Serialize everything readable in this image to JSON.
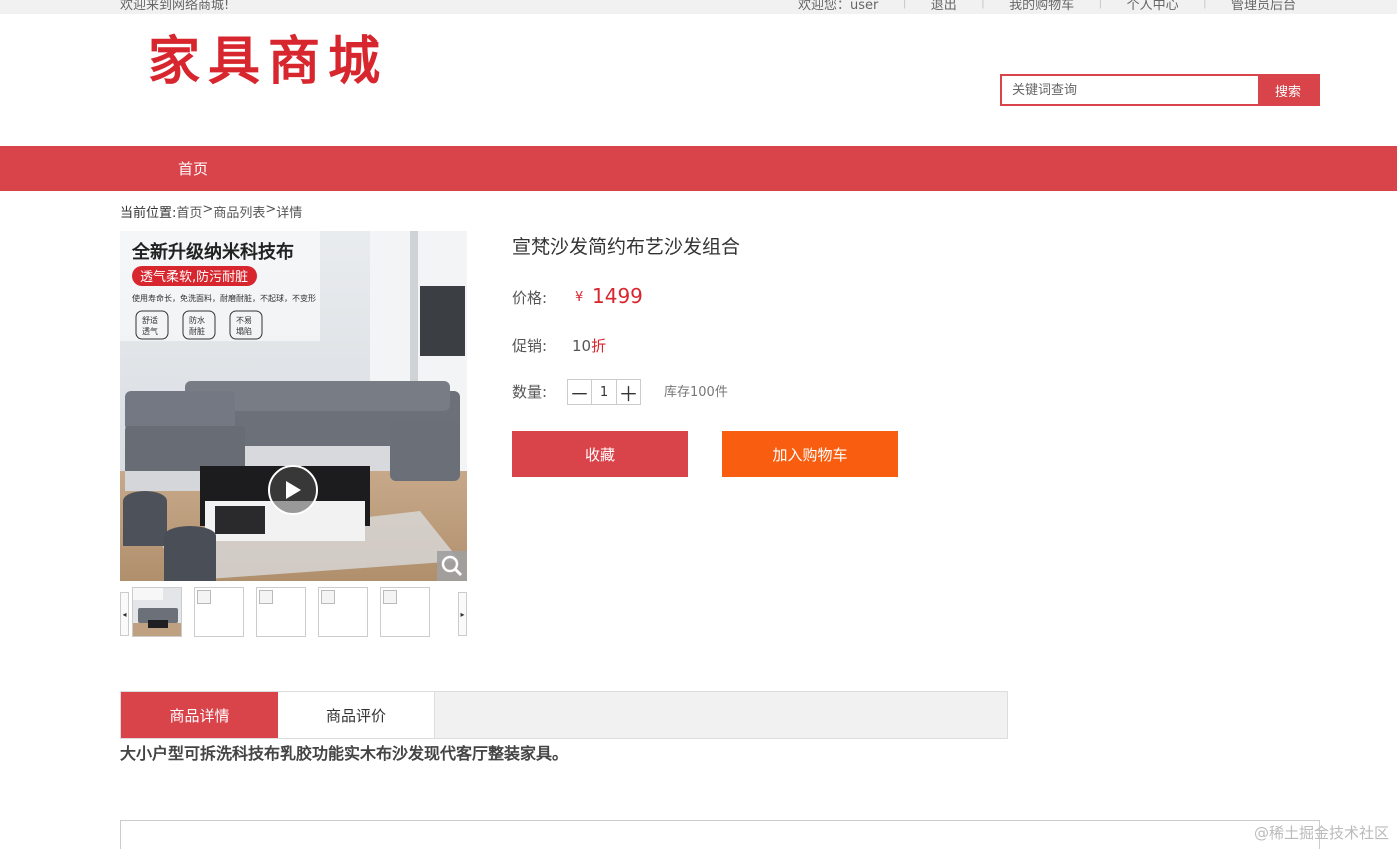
{
  "topbar": {
    "welcome": "欢迎来到网络商城!",
    "links": [
      "欢迎您：user",
      "退出",
      "我的购物车",
      "个人中心",
      "管理员后台"
    ]
  },
  "logo": "家具商城",
  "search": {
    "placeholder": "关键词查询",
    "button": "搜索"
  },
  "nav": {
    "home": "首页"
  },
  "breadcrumb": {
    "prefix": "当前位置:",
    "home": "首页",
    "sep1": ">",
    "list": "商品列表",
    "sep2": ">",
    "detail": "详情"
  },
  "image": {
    "headline": "全新升级纳米科技布",
    "badge": "透气柔软,防污耐脏",
    "subtext": "使用寿命长，免洗面料，耐磨耐脏，不起球，不变形",
    "features": [
      "舒适透气",
      "防水耐脏",
      "不易塌陷"
    ]
  },
  "product": {
    "title": "宣梵沙发简约布艺沙发组合",
    "price_label": "价格:",
    "price_currency": "¥",
    "price": "1499",
    "promo_label": "促销:",
    "promo_value": "10",
    "promo_unit": "折",
    "qty_label": "数量:",
    "qty_minus": "－",
    "qty": "1",
    "qty_plus": "＋",
    "stock": "库存100件",
    "collect": "收藏",
    "add_cart": "加入购物车"
  },
  "tabs": [
    "商品详情",
    "商品评价"
  ],
  "description": "大小户型可拆洗科技布乳胶功能实木布沙发现代客厅整装家具。",
  "watermark": "@稀土掘金技术社区",
  "colors": {
    "accent": "#d9434a",
    "cart": "#f95d0f",
    "price": "#d7262e"
  }
}
